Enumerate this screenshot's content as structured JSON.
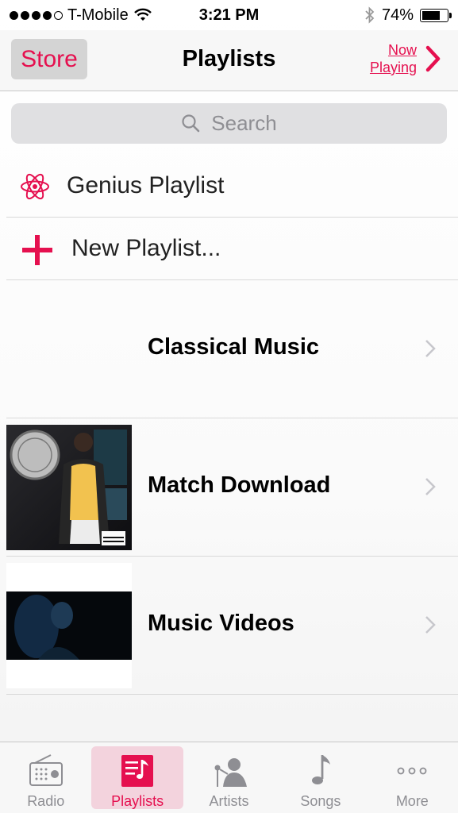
{
  "status": {
    "carrier": "T-Mobile",
    "time": "3:21 PM",
    "battery_percent": "74%",
    "battery_level": 0.74,
    "signal_bars": 4
  },
  "nav": {
    "store_label": "Store",
    "title": "Playlists",
    "now_playing_line1": "Now",
    "now_playing_line2": "Playing"
  },
  "search": {
    "placeholder": "Search"
  },
  "special_rows": {
    "genius": "Genius Playlist",
    "new_playlist": "New Playlist..."
  },
  "playlists": [
    {
      "name": "Classical Music",
      "artwork": "none"
    },
    {
      "name": "Match Download",
      "artwork": "akon-album-cover"
    },
    {
      "name": "Music Videos",
      "artwork": "dark-video-still"
    }
  ],
  "tabs": [
    {
      "label": "Radio",
      "icon": "radio-icon"
    },
    {
      "label": "Playlists",
      "icon": "playlists-icon",
      "active": true
    },
    {
      "label": "Artists",
      "icon": "artists-icon"
    },
    {
      "label": "Songs",
      "icon": "songs-icon"
    },
    {
      "label": "More",
      "icon": "more-icon"
    }
  ],
  "colors": {
    "accent": "#e5104f",
    "inactive": "#8e8e93"
  }
}
